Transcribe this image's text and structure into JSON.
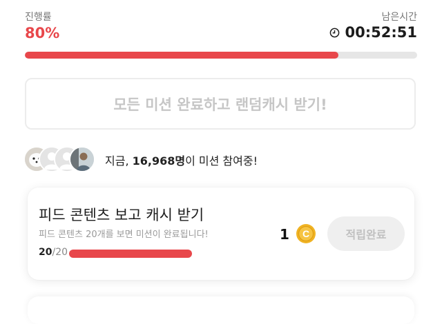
{
  "header": {
    "progress_label": "진행률",
    "progress_value": "80%",
    "progress_fraction": 0.8,
    "remaining_label": "남은시간",
    "remaining_time": "00:52:51"
  },
  "main_button": {
    "label": "모든 미션 완료하고 랜덤캐시 받기!"
  },
  "participants": {
    "prefix": "지금, ",
    "count": "16,968명",
    "suffix": "이 미션 참여중!"
  },
  "mission": {
    "title": "피드 콘텐츠 보고 캐시 받기",
    "description": "피드 콘텐츠 20개를 보면 미션이 완료됩니다!",
    "progress_current": "20",
    "progress_total": "/20",
    "progress_fraction": 1.0,
    "reward_amount": "1",
    "coin_symbol": "C",
    "claim_label": "적립완료"
  },
  "colors": {
    "accent": "#e8474b",
    "coin": "#f0b323",
    "disabled_text": "#c6c6c6"
  }
}
